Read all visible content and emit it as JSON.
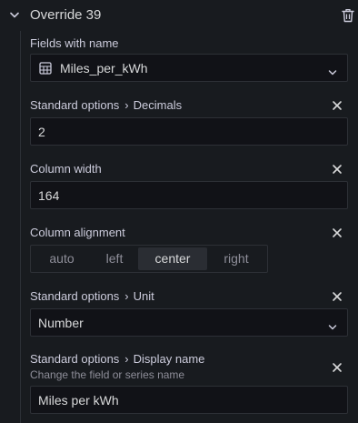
{
  "override": {
    "title": "Override 39"
  },
  "fields_with_name": {
    "label": "Fields with name",
    "value": "Miles_per_kWh"
  },
  "decimals": {
    "category": "Standard options",
    "label": "Decimals",
    "value": "2"
  },
  "column_width": {
    "label": "Column width",
    "value": "164"
  },
  "column_alignment": {
    "label": "Column alignment",
    "options": [
      "auto",
      "left",
      "center",
      "right"
    ],
    "selected": "center"
  },
  "unit": {
    "category": "Standard options",
    "label": "Unit",
    "value": "Number"
  },
  "display_name": {
    "category": "Standard options",
    "label": "Display name",
    "description": "Change the field or series name",
    "value": "Miles per kWh"
  },
  "colors": {
    "background": "#181b1f",
    "input_bg": "#111217",
    "border": "#2d3036",
    "text": "#ccccdc",
    "muted": "#8e8e99"
  },
  "icons": {
    "collapse": "chevron-down-icon",
    "delete": "trash-icon",
    "field_matcher": "table-grid-icon",
    "remove_property": "close-icon",
    "dropdown": "caret-down-icon"
  }
}
